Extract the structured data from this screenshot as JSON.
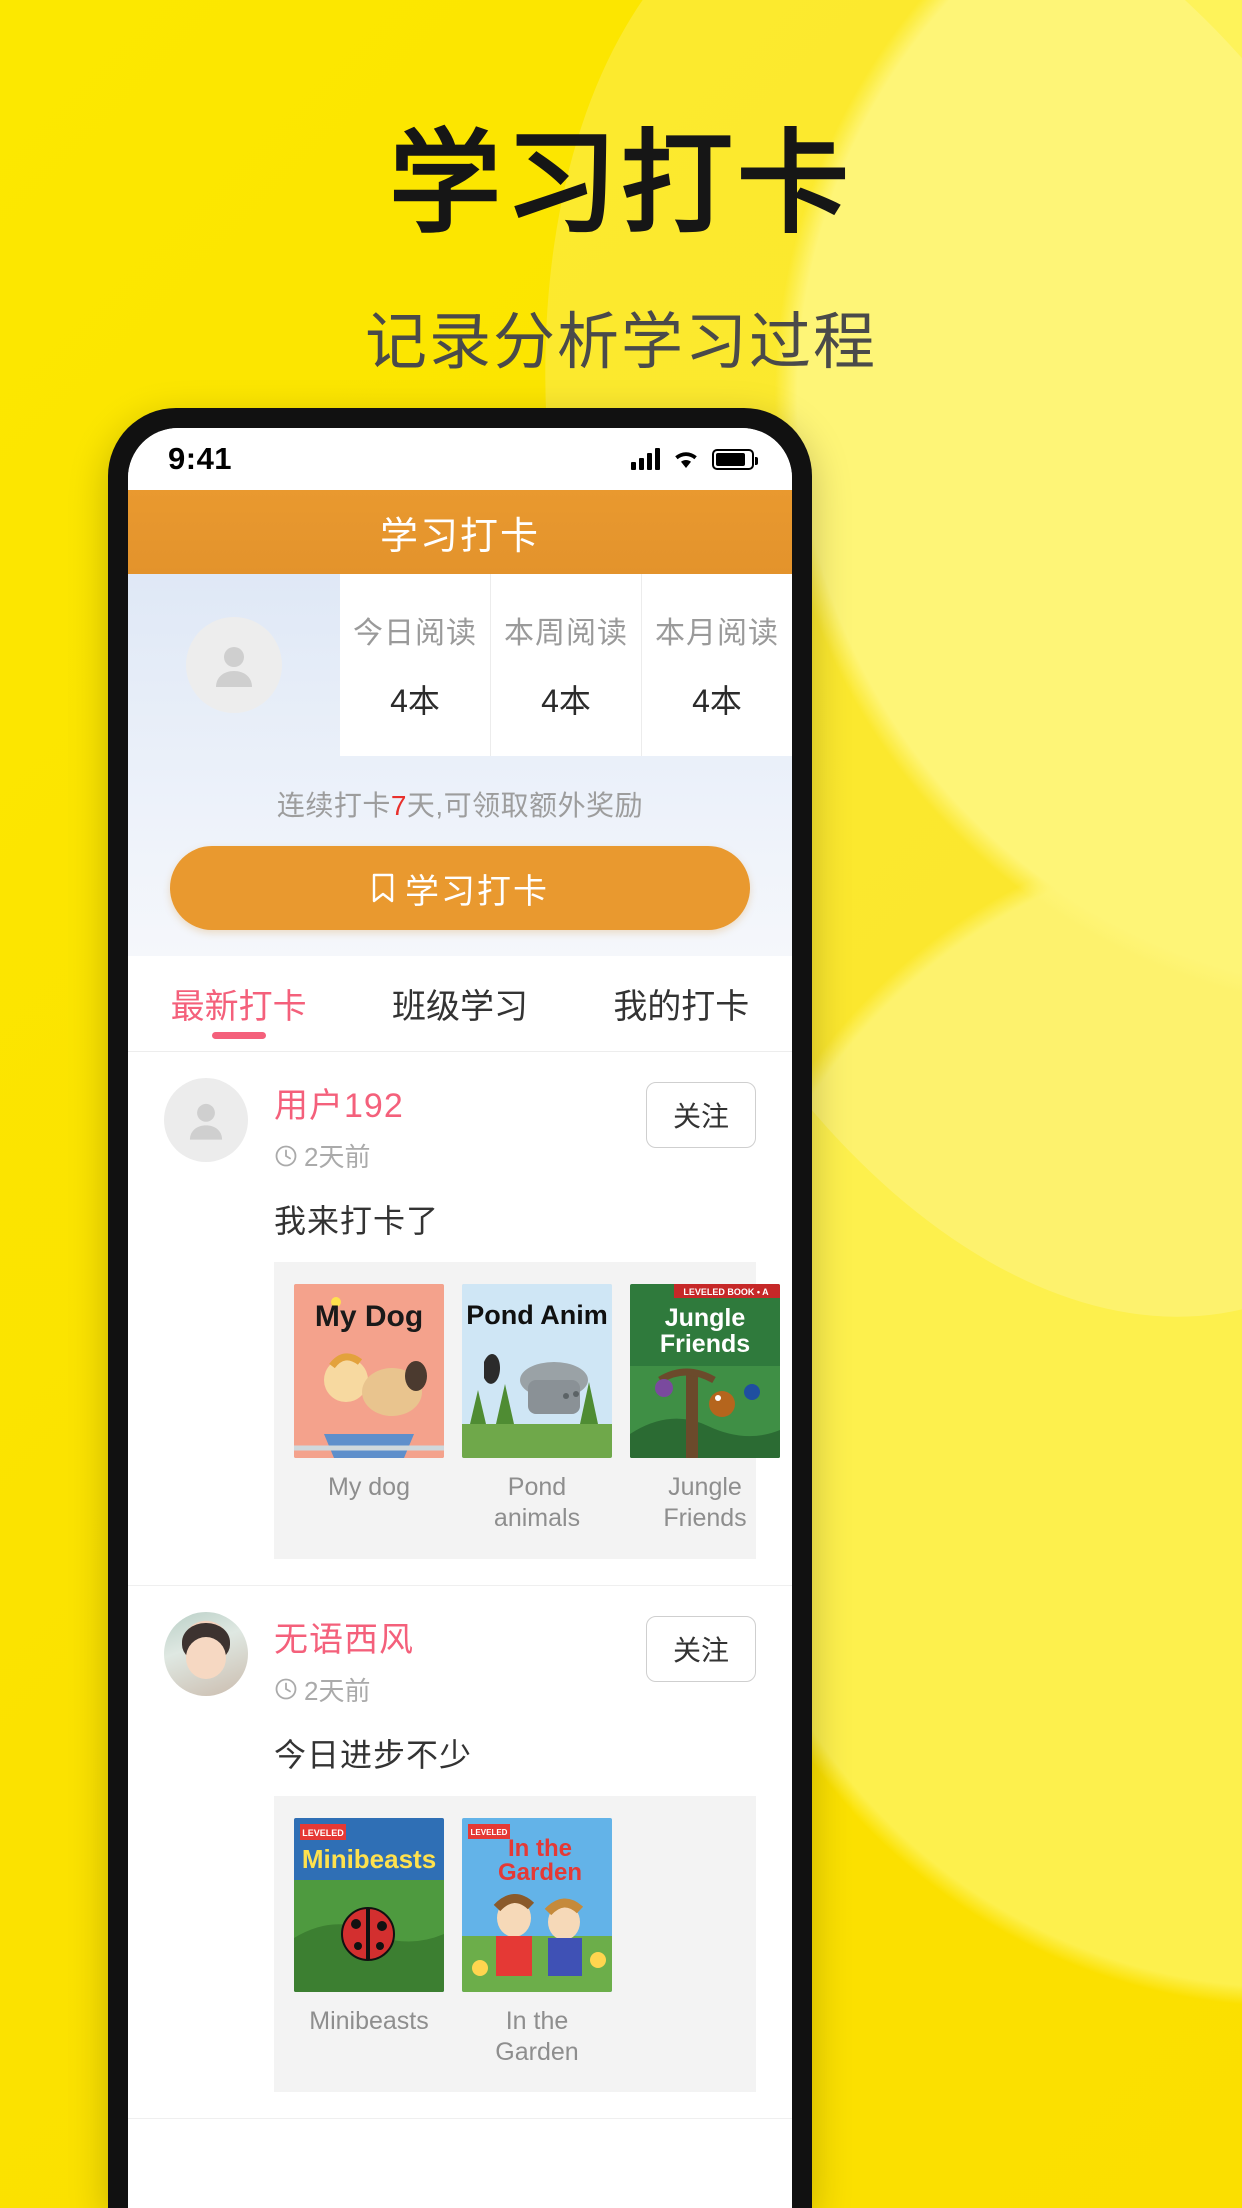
{
  "hero": {
    "title": "学习打卡",
    "subtitle": "记录分析学习过程"
  },
  "colors": {
    "background": "#FCE303",
    "appbar": "#E9992F",
    "accent_pink": "#F4607B",
    "streak_red": "#E8302C"
  },
  "phone": {
    "statusbar": {
      "time": "9:41",
      "signal_icon": "cellular-bars-icon",
      "wifi_icon": "wifi-icon",
      "battery_icon": "battery-icon"
    },
    "appbar": {
      "title": "学习打卡"
    },
    "stats": {
      "avatar_icon": "user-avatar-icon",
      "items": [
        {
          "label": "今日阅读",
          "value": "4本"
        },
        {
          "label": "本周阅读",
          "value": "4本"
        },
        {
          "label": "本月阅读",
          "value": "4本"
        }
      ]
    },
    "streak": {
      "prefix": "连续打卡",
      "days": "7",
      "suffix": "天,可领取额外奖励"
    },
    "checkin_button": {
      "icon": "bookmark-icon",
      "label": "学习打卡"
    },
    "tabs": [
      {
        "label": "最新打卡",
        "active": true
      },
      {
        "label": "班级学习",
        "active": false
      },
      {
        "label": "我的打卡",
        "active": false
      }
    ],
    "feed": [
      {
        "avatar_icon": "user-avatar-icon",
        "name": "用户192",
        "time": "2天前",
        "time_icon": "clock-icon",
        "follow_label": "关注",
        "text": "我来打卡了",
        "books": [
          {
            "title": "My dog",
            "cover_text": "My Dog"
          },
          {
            "title": "Pond animals",
            "cover_text": "Pond Anim"
          },
          {
            "title": "Jungle Friends",
            "cover_text": "Jungle Friends"
          }
        ]
      },
      {
        "avatar_icon": "child-photo-avatar",
        "name": "无语西风",
        "time": "2天前",
        "time_icon": "clock-icon",
        "follow_label": "关注",
        "text": "今日进步不少",
        "books": [
          {
            "title": "Minibeasts",
            "cover_text": "Minibeasts"
          },
          {
            "title": "In the Garden",
            "cover_text": "In the Garden"
          }
        ]
      }
    ]
  }
}
